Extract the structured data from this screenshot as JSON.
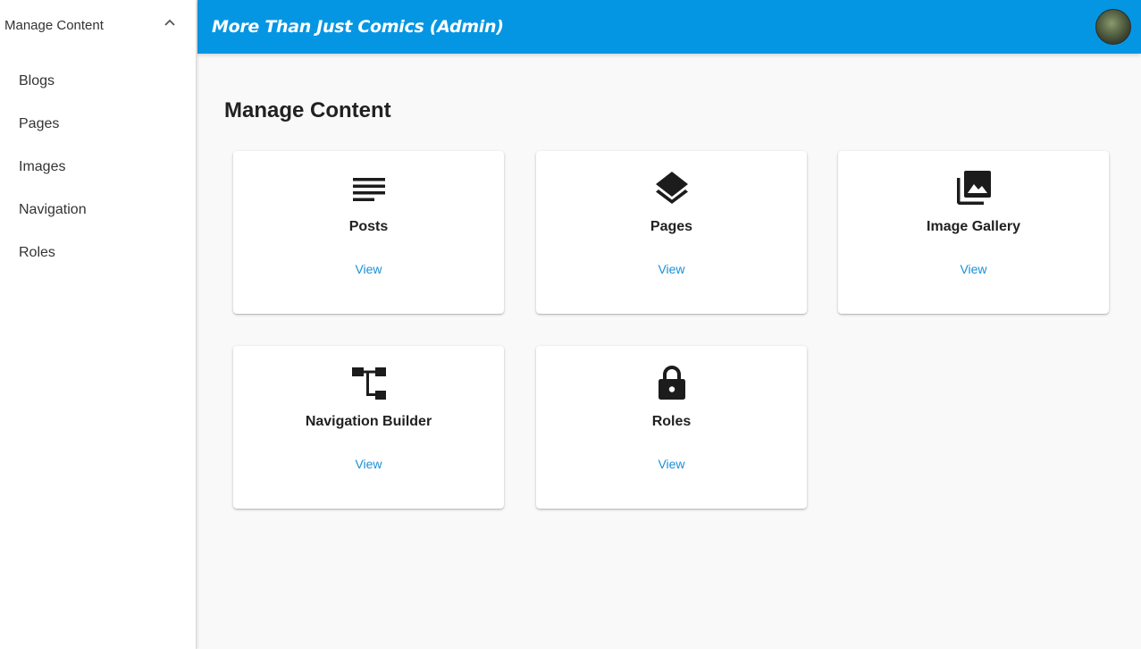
{
  "sidebar": {
    "header": {
      "label": "Manage Content",
      "icon": "chevron-up-icon"
    },
    "items": [
      {
        "label": "Blogs"
      },
      {
        "label": "Pages"
      },
      {
        "label": "Images"
      },
      {
        "label": "Navigation"
      },
      {
        "label": "Roles"
      }
    ]
  },
  "appbar": {
    "title": "More Than Just Comics (Admin)",
    "background": "#0596e3"
  },
  "main": {
    "title": "Manage Content",
    "cards": [
      {
        "title": "Posts",
        "icon": "subject-icon",
        "action": "View"
      },
      {
        "title": "Pages",
        "icon": "layers-icon",
        "action": "View"
      },
      {
        "title": "Image Gallery",
        "icon": "photo-library-icon",
        "action": "View"
      },
      {
        "title": "Navigation Builder",
        "icon": "tree-icon",
        "action": "View"
      },
      {
        "title": "Roles",
        "icon": "lock-icon",
        "action": "View"
      }
    ]
  },
  "colors": {
    "accent": "#1a8fd8",
    "icon": "#1c1c1c"
  }
}
